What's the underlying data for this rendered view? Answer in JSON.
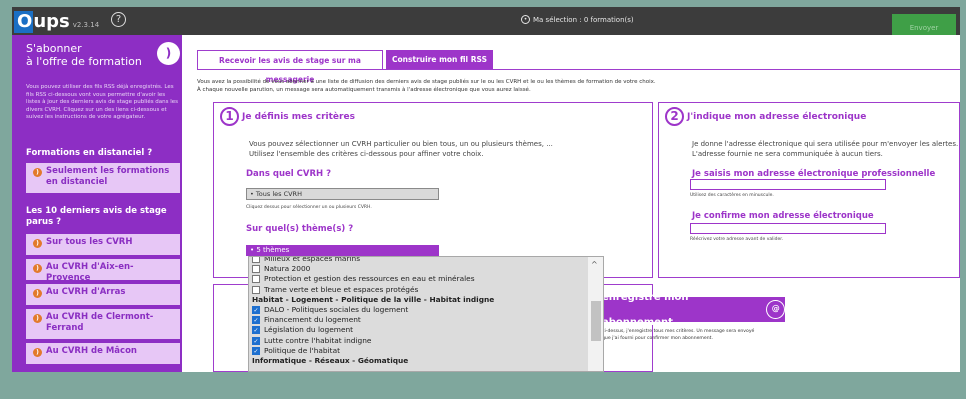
{
  "app": {
    "logo_o": "O",
    "logo_ups": "ups",
    "version": "v2.3.14",
    "help": "?"
  },
  "topbar": {
    "selection_icon": "•",
    "selection": "Ma sélection : 0 formation(s)",
    "green_button": "Envoyer"
  },
  "sidebar": {
    "title_line1": "S'abonner",
    "title_line2": "à l'offre de formation",
    "rss_icon": "rss-icon",
    "intro": "Vous pouvez utiliser des fils RSS déjà enregistrés. Les fils RSS ci-dessous vont vous permettre d'avoir les listes à jour des derniers avis de stage publiés dans les divers CVRH. Cliquez sur un des liens ci-dessous et suivez les instructions de votre agrégateur.",
    "heading_distanciel": "Formations en distanciel ?",
    "btn_distanciel": "Seulement les formations en distanciel",
    "heading_derniers": "Les 10 derniers avis de stage parus ?",
    "items": [
      "Sur tous les CVRH",
      "Au CVRH d'Aix-en-Provence",
      "Au CVRH d'Arras",
      "Au CVRH de Clermont-Ferrand",
      "Au CVRH de Mâcon"
    ]
  },
  "tabs": {
    "tab1": "Recevoir les avis de stage sur ma messagerie",
    "tab2": "Construire mon fil RSS"
  },
  "intro": {
    "line1": "Vous avez la possibilité de vous abonner à une liste de diffusion des derniers avis de stage publiés sur le ou les CVRH et le ou les thèmes de formation de votre choix.",
    "line2": "À chaque nouvelle parution, un message sera automatiquement transmis à l'adresse électronique que vous aurez laissé."
  },
  "step1": {
    "num": "1",
    "title": "Je définis mes critères",
    "text1": "Vous pouvez sélectionner un CVRH particulier ou bien tous, un ou plusieurs thèmes, ...",
    "text2": "Utilisez l'ensemble des critères ci-dessous pour affiner votre choix.",
    "cvrh_label": "Dans quel CVRH ?",
    "cvrh_value": "• Tous les CVRH",
    "cvrh_hint": "Cliquez dessus pour sélectionner un ou plusieurs CVRH.",
    "theme_label": "Sur quel(s) thème(s) ?",
    "theme_value": "• 5 thèmes"
  },
  "step2": {
    "num": "2",
    "title": "J'indique mon adresse électronique",
    "text1": "Je donne l'adresse électronique qui sera utilisée pour m'envoyer les alertes.",
    "text2": "L'adresse fournie ne sera communiquée à aucun tiers.",
    "email_label": "Je saisis mon adresse électronique professionnelle",
    "email_hint": "Utilisez des caractères en minuscule.",
    "confirm_label": "Je confirme mon adresse électronique",
    "confirm_hint": "Réécrivez votre adresse avant de valider."
  },
  "step3": {
    "button": "enregistre mon abonnement",
    "button_icon": "email-icon",
    "text1": "ci-dessus, j'enregistre tous mes critères. Un message sera envoyé",
    "text2": "que j'ai fourni pour confirmer mon abonnement."
  },
  "dropdown": {
    "rows": [
      {
        "label": "Milieux et espaces marins",
        "type": "item",
        "checked": false
      },
      {
        "label": "Natura 2000",
        "type": "item",
        "checked": false
      },
      {
        "label": "Protection et gestion des ressources en eau et minérales",
        "type": "item",
        "checked": false
      },
      {
        "label": "Trame verte et bleue et espaces protégés",
        "type": "item",
        "checked": false
      },
      {
        "label": "Habitat - Logement - Politique de la ville - Habitat indigne",
        "type": "group",
        "checked": false
      },
      {
        "label": "DALO - Politiques sociales du logement",
        "type": "item",
        "checked": true
      },
      {
        "label": "Financement du logement",
        "type": "item",
        "checked": true
      },
      {
        "label": "Législation du logement",
        "type": "item",
        "checked": true
      },
      {
        "label": "Lutte contre l'habitat indigne",
        "type": "item",
        "checked": true
      },
      {
        "label": "Politique de l'habitat",
        "type": "item",
        "checked": true
      },
      {
        "label": "Informatique - Réseaux - Géomatique",
        "type": "group",
        "checked": false
      }
    ]
  }
}
